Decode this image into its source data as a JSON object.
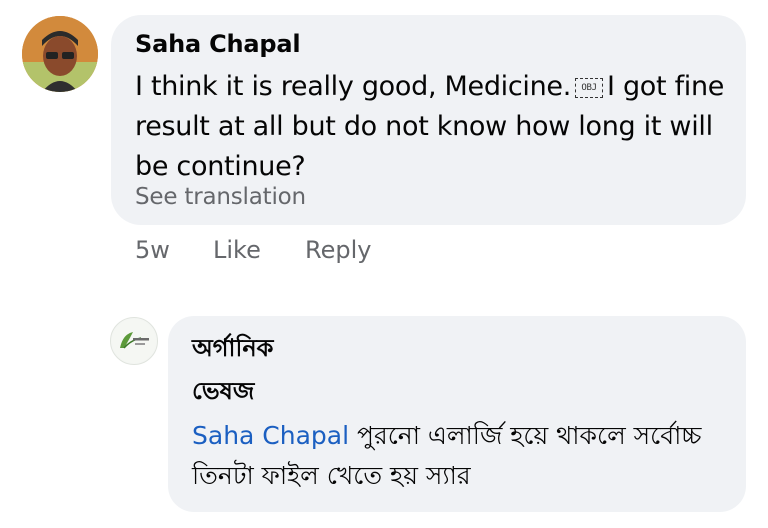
{
  "comment": {
    "author": "Saha Chapal",
    "text_before_icon": "I think it is really good, Medicine.",
    "inline_icon": "OBJ",
    "text_after_icon": "I got fine result at all but do not know how long it will be continue?",
    "see_translation": "See translation",
    "time": "5w",
    "like_label": "Like",
    "reply_label": "Reply"
  },
  "reply": {
    "author_line1": "অর্গানিক",
    "author_line2": "ভেষজ",
    "mention": "Saha Chapal",
    "text": "পুরনো এলার্জি হয়ে থাকলে সর্বোচ্চ তিনটা ফাইল খেতে হয় স্যার"
  }
}
